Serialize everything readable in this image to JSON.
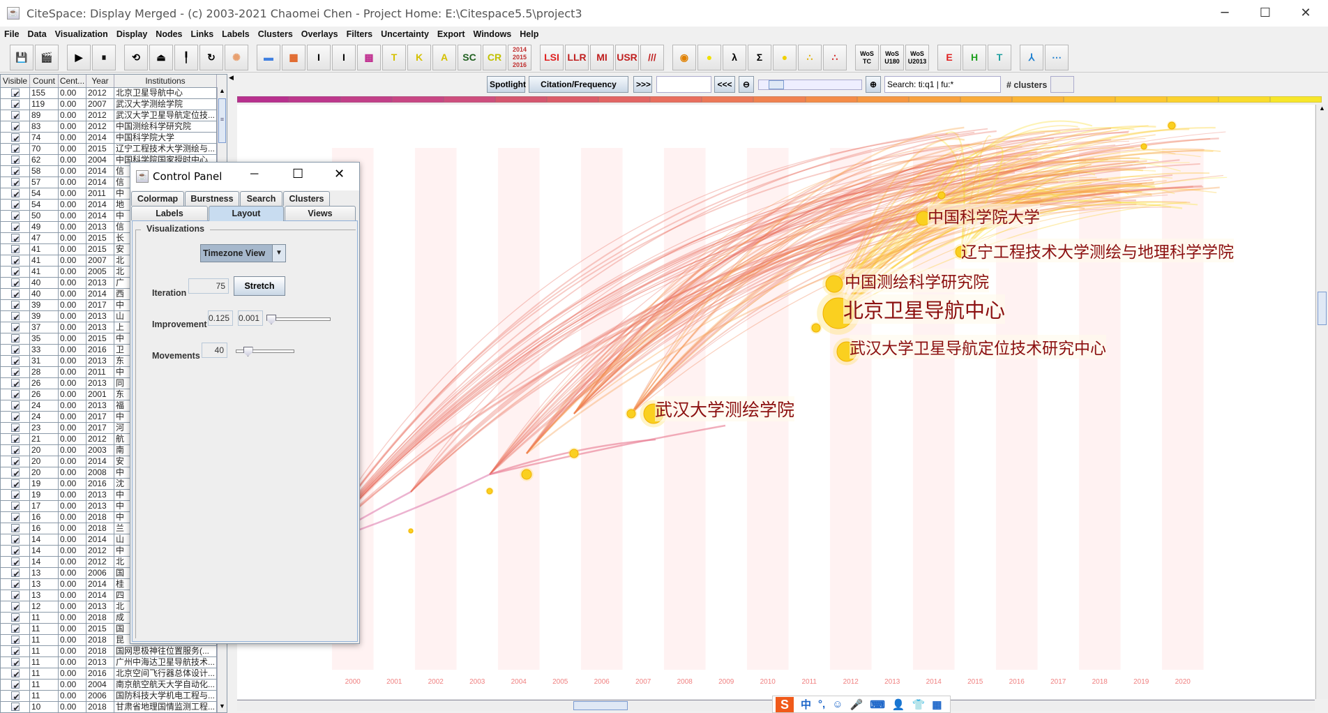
{
  "window": {
    "title": "CiteSpace: Display Merged - (c) 2003-2021 Chaomei Chen - Project Home: E:\\Citespace5.5\\project3",
    "min": "─",
    "max": "☐",
    "close": "✕"
  },
  "menu": [
    "File",
    "Data",
    "Visualization",
    "Display",
    "Nodes",
    "Links",
    "Labels",
    "Clusters",
    "Overlays",
    "Filters",
    "Uncertainty",
    "Export",
    "Windows",
    "Help"
  ],
  "toolbar": [
    {
      "icon": "save-icon",
      "label": "💾"
    },
    {
      "icon": "clapperboard-icon",
      "label": "🎬"
    },
    {
      "gap": true
    },
    {
      "icon": "play-icon",
      "label": "▶"
    },
    {
      "icon": "pause-icon",
      "label": "⏸"
    },
    {
      "gap": true
    },
    {
      "icon": "rotate-icon",
      "label": "⟲"
    },
    {
      "icon": "hat-icon",
      "label": "⏏"
    },
    {
      "icon": "pin-icon",
      "label": "╿"
    },
    {
      "icon": "refresh-icon",
      "label": "↻"
    },
    {
      "icon": "starburst-icon",
      "label": "✺",
      "color": "#e8a070"
    },
    {
      "gap": true
    },
    {
      "icon": "colorbar-icon",
      "label": "▬",
      "color": "#4080e0"
    },
    {
      "icon": "color-grid-icon",
      "label": "▦",
      "color": "#e06020"
    },
    {
      "icon": "i-beam-bold-icon",
      "label": "I"
    },
    {
      "icon": "i-beam-icon",
      "label": "I"
    },
    {
      "icon": "pattern-icon",
      "label": "▩",
      "color": "#c03090"
    },
    {
      "icon": "triangle-t-icon",
      "label": "T",
      "color": "#d4c000"
    },
    {
      "icon": "triangle-k-icon",
      "label": "K",
      "color": "#d4c000"
    },
    {
      "icon": "triangle-a-icon",
      "label": "A",
      "color": "#d4c000"
    },
    {
      "icon": "sc-icon",
      "label": "SC",
      "color": "#206020"
    },
    {
      "icon": "cr-icon",
      "label": "CR",
      "color": "#c0c000"
    },
    {
      "icon": "years-icon",
      "label": "2014 2015 2016",
      "color": "#c03030",
      "small": true
    },
    {
      "gap": true
    },
    {
      "icon": "lsi-icon",
      "label": "LSI",
      "color": "#e02020"
    },
    {
      "icon": "llr-icon",
      "label": "LLR",
      "color": "#c02020"
    },
    {
      "icon": "mi-icon",
      "label": "MI",
      "color": "#c02020"
    },
    {
      "icon": "usr-icon",
      "label": "USR",
      "color": "#c02020"
    },
    {
      "icon": "slashes-icon",
      "label": "///",
      "color": "#c02020"
    },
    {
      "gap": true
    },
    {
      "icon": "donut-icon",
      "label": "◉",
      "color": "#e08000"
    },
    {
      "icon": "circle-icon",
      "label": "●",
      "color": "#f0e000"
    },
    {
      "icon": "lambda-icon",
      "label": "λ"
    },
    {
      "icon": "sigma-icon",
      "label": "Σ"
    },
    {
      "icon": "bubbles-icon",
      "label": "●",
      "color": "#f0d000"
    },
    {
      "icon": "chain-icon",
      "label": "∴",
      "color": "#e0b000"
    },
    {
      "icon": "rgb-dots-icon",
      "label": "∴",
      "color": "#d02020"
    },
    {
      "gap": true
    },
    {
      "icon": "wos-tc-icon",
      "label": "WoS TC",
      "small": true
    },
    {
      "icon": "wos-u180-icon",
      "label": "WoS U180",
      "small": true
    },
    {
      "icon": "wos-u2013-icon",
      "label": "WoS U2013",
      "small": true
    },
    {
      "gap": true
    },
    {
      "icon": "e-icon",
      "label": "E",
      "color": "#e02020"
    },
    {
      "icon": "h-icon",
      "label": "H",
      "color": "#20a020"
    },
    {
      "icon": "t-icon",
      "label": "T",
      "color": "#20a0a0"
    },
    {
      "gap": true
    },
    {
      "icon": "network-icon",
      "label": "⅄",
      "color": "#2080d0"
    },
    {
      "icon": "timeline-icon",
      "label": "⋯",
      "color": "#2080d0"
    }
  ],
  "table": {
    "headers": [
      "Visible",
      "Count",
      "Cent...",
      "Year",
      "Institutions"
    ],
    "rows": [
      [
        "155",
        "0.00",
        "2012",
        "北京卫星导航中心"
      ],
      [
        "119",
        "0.00",
        "2007",
        "武汉大学测绘学院"
      ],
      [
        "89",
        "0.00",
        "2012",
        "武汉大学卫星导航定位技..."
      ],
      [
        "83",
        "0.00",
        "2012",
        "中国测绘科学研究院"
      ],
      [
        "74",
        "0.00",
        "2014",
        "中国科学院大学"
      ],
      [
        "70",
        "0.00",
        "2015",
        "辽宁工程技术大学测绘与..."
      ],
      [
        "62",
        "0.00",
        "2004",
        "中国科学院国家授时中心"
      ],
      [
        "58",
        "0.00",
        "2014",
        "信"
      ],
      [
        "57",
        "0.00",
        "2014",
        "信"
      ],
      [
        "54",
        "0.00",
        "2011",
        "中"
      ],
      [
        "54",
        "0.00",
        "2014",
        "地"
      ],
      [
        "50",
        "0.00",
        "2014",
        "中"
      ],
      [
        "49",
        "0.00",
        "2013",
        "信"
      ],
      [
        "47",
        "0.00",
        "2015",
        "长"
      ],
      [
        "41",
        "0.00",
        "2015",
        "安"
      ],
      [
        "41",
        "0.00",
        "2007",
        "北"
      ],
      [
        "41",
        "0.00",
        "2005",
        "北"
      ],
      [
        "40",
        "0.00",
        "2013",
        "广"
      ],
      [
        "40",
        "0.00",
        "2014",
        "西"
      ],
      [
        "39",
        "0.00",
        "2017",
        "中"
      ],
      [
        "39",
        "0.00",
        "2013",
        "山"
      ],
      [
        "37",
        "0.00",
        "2013",
        "上"
      ],
      [
        "35",
        "0.00",
        "2015",
        "中"
      ],
      [
        "33",
        "0.00",
        "2016",
        "卫"
      ],
      [
        "31",
        "0.00",
        "2013",
        "东"
      ],
      [
        "28",
        "0.00",
        "2011",
        "中"
      ],
      [
        "26",
        "0.00",
        "2013",
        "同"
      ],
      [
        "26",
        "0.00",
        "2001",
        "东"
      ],
      [
        "24",
        "0.00",
        "2013",
        "福"
      ],
      [
        "24",
        "0.00",
        "2017",
        "中"
      ],
      [
        "23",
        "0.00",
        "2017",
        "河"
      ],
      [
        "21",
        "0.00",
        "2012",
        "航"
      ],
      [
        "20",
        "0.00",
        "2003",
        "南"
      ],
      [
        "20",
        "0.00",
        "2014",
        "安"
      ],
      [
        "20",
        "0.00",
        "2008",
        "中"
      ],
      [
        "19",
        "0.00",
        "2016",
        "沈"
      ],
      [
        "19",
        "0.00",
        "2013",
        "中"
      ],
      [
        "17",
        "0.00",
        "2013",
        "中"
      ],
      [
        "16",
        "0.00",
        "2018",
        "中"
      ],
      [
        "16",
        "0.00",
        "2018",
        "兰"
      ],
      [
        "14",
        "0.00",
        "2014",
        "山"
      ],
      [
        "14",
        "0.00",
        "2012",
        "中"
      ],
      [
        "14",
        "0.00",
        "2012",
        "北"
      ],
      [
        "13",
        "0.00",
        "2006",
        "国"
      ],
      [
        "13",
        "0.00",
        "2014",
        "桂"
      ],
      [
        "13",
        "0.00",
        "2014",
        "四"
      ],
      [
        "12",
        "0.00",
        "2013",
        "北"
      ],
      [
        "11",
        "0.00",
        "2018",
        "成"
      ],
      [
        "11",
        "0.00",
        "2015",
        "国"
      ],
      [
        "11",
        "0.00",
        "2018",
        "昆"
      ],
      [
        "11",
        "0.00",
        "2018",
        "国网思极神往位置服务(..."
      ],
      [
        "11",
        "0.00",
        "2013",
        "广州中海达卫星导航技术..."
      ],
      [
        "11",
        "0.00",
        "2016",
        "北京空间飞行器总体设计..."
      ],
      [
        "11",
        "0.00",
        "2004",
        "南京航空航天大学自动化..."
      ],
      [
        "11",
        "0.00",
        "2006",
        "国防科技大学机电工程与..."
      ],
      [
        "10",
        "0.00",
        "2018",
        "甘肃省地理国情监测工程..."
      ]
    ]
  },
  "controls": {
    "spotlight": "Spotlight",
    "burst": "Citation/Frequency Burst",
    "forward": ">>>",
    "back": "<<<",
    "search_value": "Search: ti:q1 | fu:*",
    "clusters_label": "# clusters"
  },
  "colorbar": [
    "#b8308e",
    "#bd378c",
    "#c23f88",
    "#c84684",
    "#ce4e7e",
    "#d5566f",
    "#db5c69",
    "#e26564",
    "#e86e5e",
    "#ec7858",
    "#f08250",
    "#f48c48",
    "#f69742",
    "#f8a13e",
    "#faab3a",
    "#fbb536",
    "#fcbf32",
    "#fcc830",
    "#fbd22e",
    "#f9dc2c",
    "#f7e62a"
  ],
  "years": [
    "2000",
    "2001",
    "2002",
    "2003",
    "2004",
    "2005",
    "2006",
    "2007",
    "2008",
    "2009",
    "2010",
    "2011",
    "2012",
    "2013",
    "2014",
    "2015",
    "2016",
    "2017",
    "2018",
    "2019",
    "2020"
  ],
  "stripe_color": "#fff2f2",
  "labels": {
    "l1": "中国科学院大学",
    "l2": "辽宁工程技术大学测绘与地理科学学院",
    "l3": "中国测绘科学研究院",
    "l4": "北京卫星导航中心",
    "l5": "武汉大学卫星导航定位技术研究中心",
    "l6": "武汉大学测绘学院"
  },
  "control_panel": {
    "title": "Control Panel",
    "tabs_row1": [
      "Colormap",
      "Burstness",
      "Search",
      "Clusters"
    ],
    "tabs_row2": [
      "Labels",
      "Layout",
      "Views"
    ],
    "active_tab": "Layout",
    "group": "Visualizations",
    "view_select": "Timezone View",
    "iteration_label": "Iteration",
    "iteration": "75",
    "stretch": "Stretch",
    "improvement_label": "Improvement",
    "improvement1": "0.125",
    "improvement2": "0.001",
    "improvement_slider": 0.0,
    "movements_label": "Movements",
    "movements": "40",
    "movements_slider": 0.15
  },
  "ime": {
    "logo": "S",
    "items": [
      "中",
      "°,",
      "☺",
      "🎤",
      "⌨",
      "👤",
      "👕",
      "▦"
    ]
  }
}
